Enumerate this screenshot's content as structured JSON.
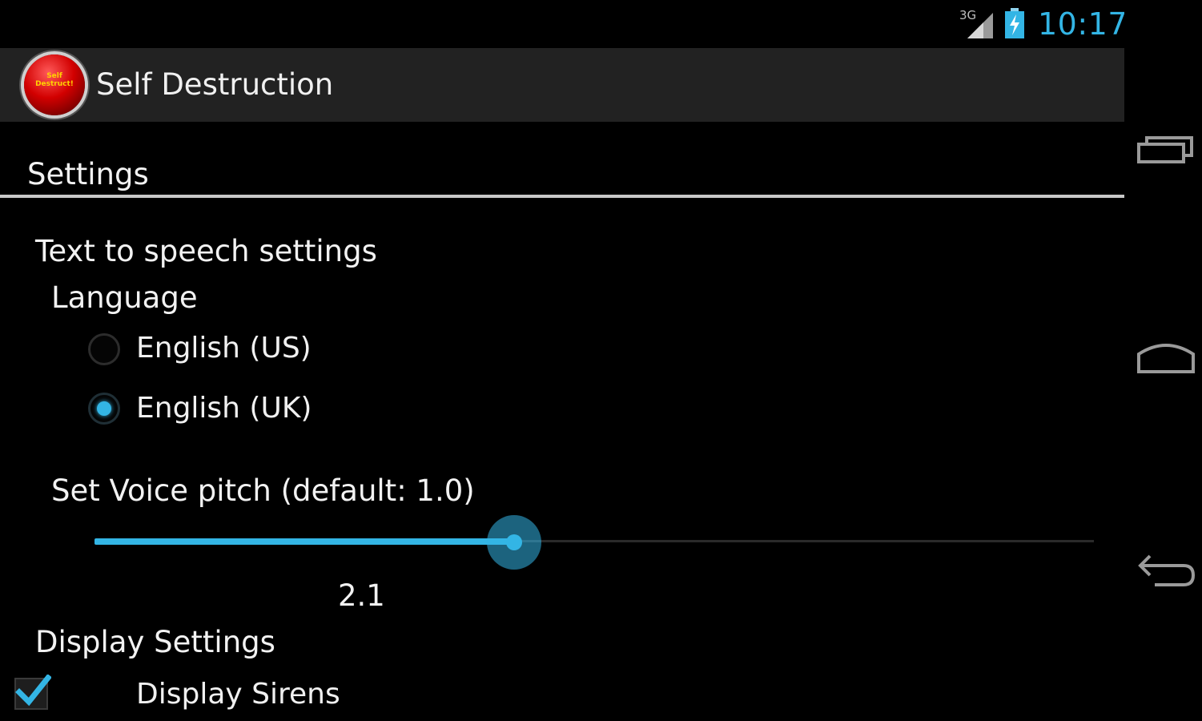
{
  "status_bar": {
    "network": "3G",
    "time": "10:17"
  },
  "action_bar": {
    "app_icon_text": "Self Destruct!",
    "title": "Self Destruction"
  },
  "settings": {
    "section_title": "Settings",
    "tts": {
      "title": "Text to speech settings",
      "language_label": "Language",
      "options": [
        {
          "label": "English (US)",
          "selected": false
        },
        {
          "label": "English (UK)",
          "selected": true
        }
      ],
      "pitch_label": "Set Voice pitch (default: 1.0)",
      "pitch_value": "2.1",
      "pitch_fraction": 0.42
    },
    "display": {
      "title": "Display Settings",
      "sirens_label": "Display Sirens",
      "sirens_checked": true
    }
  },
  "colors": {
    "accent": "#33b5e5",
    "action_bar_bg": "#222222",
    "background": "#000000"
  },
  "nav_icons": [
    "recent-apps-icon",
    "home-icon",
    "back-icon"
  ]
}
